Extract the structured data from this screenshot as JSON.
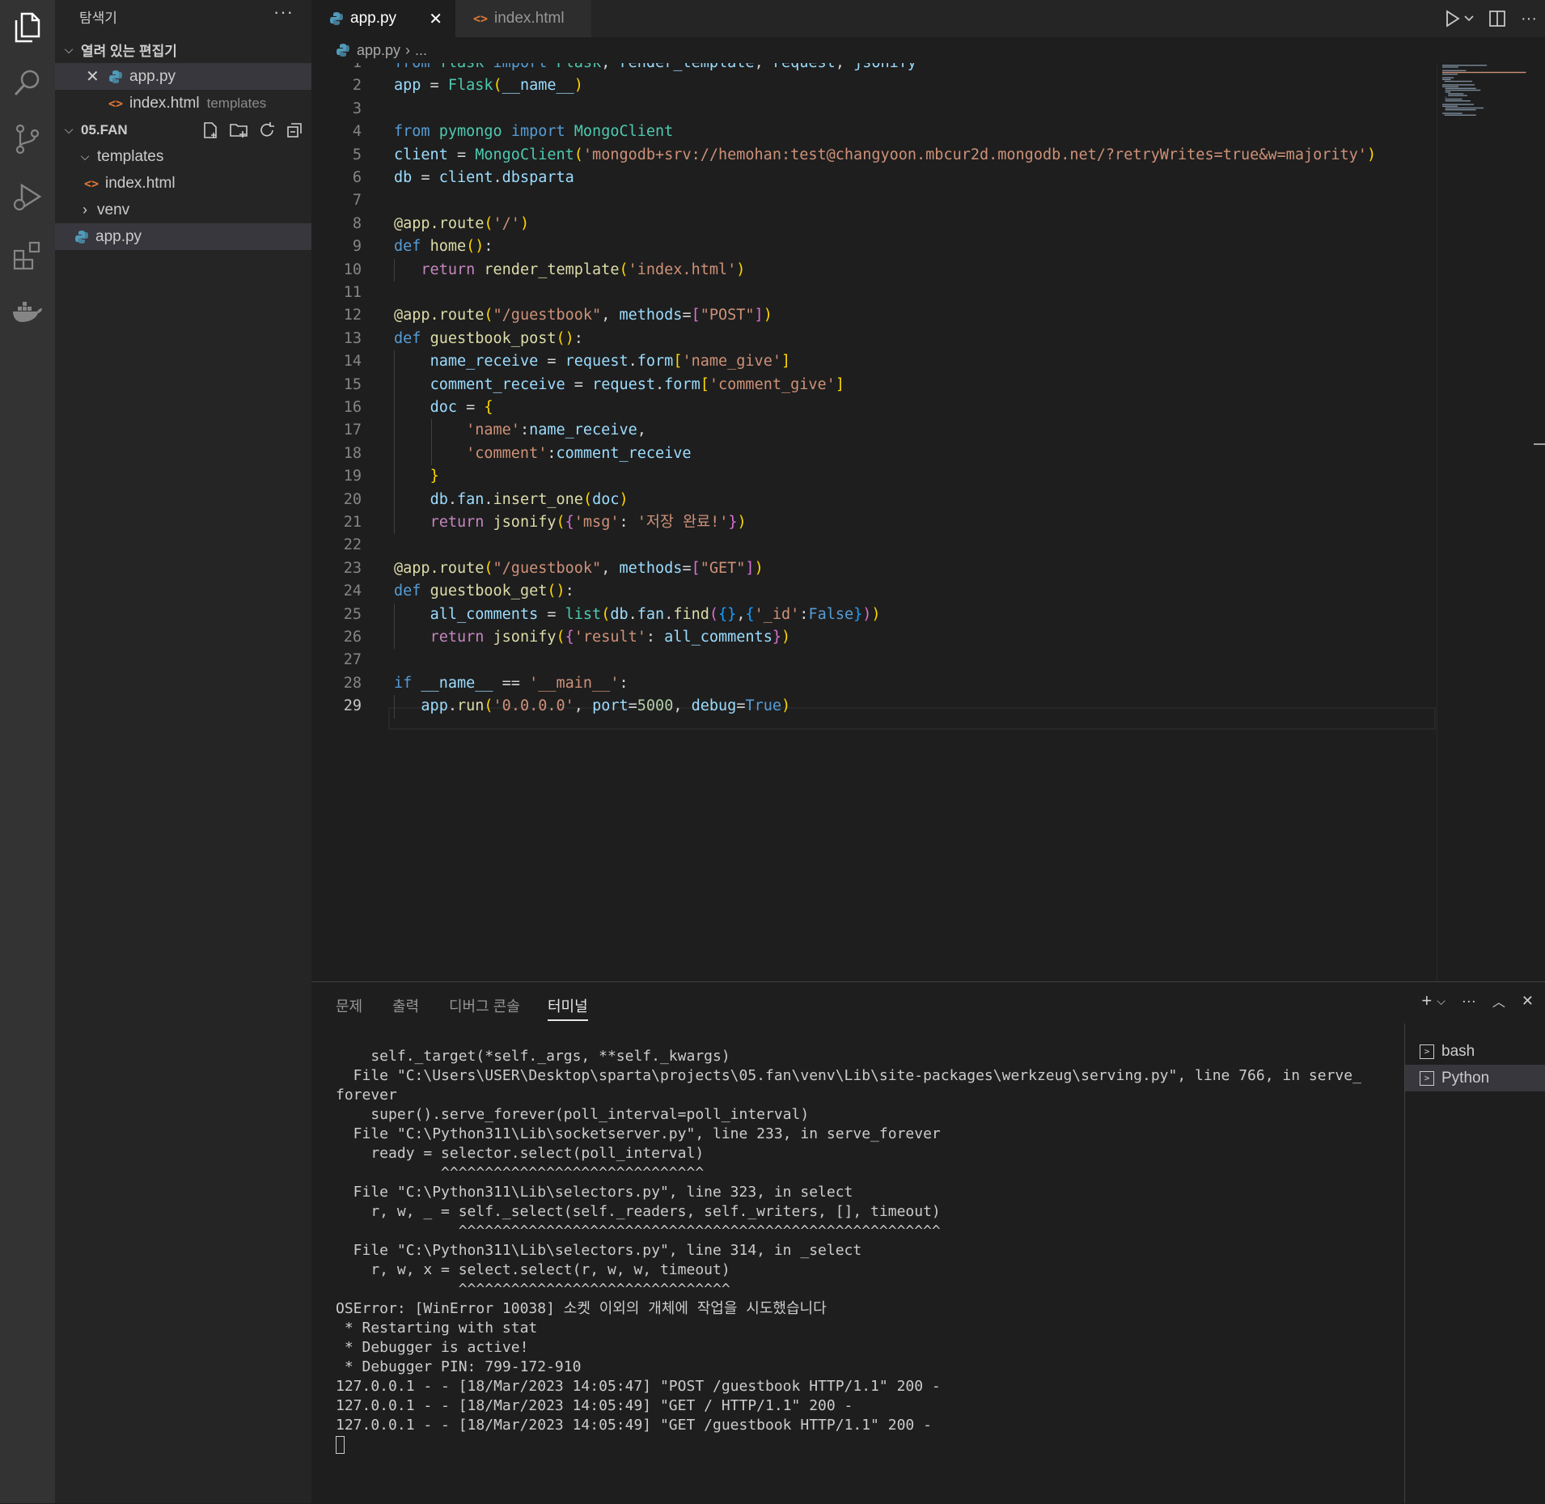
{
  "colors": {
    "accent": "#007acc",
    "python_icon": "#519aba",
    "html_icon": "#e37933"
  },
  "sidebar": {
    "title": "탐색기",
    "open_editors_label": "열려 있는 편집기",
    "open_editors": [
      {
        "name": "app.py",
        "desc": ""
      },
      {
        "name": "index.html",
        "desc": "templates"
      }
    ],
    "project_label": "05.FAN",
    "tree": [
      {
        "name": "templates",
        "type": "folder",
        "expanded": true
      },
      {
        "name": "index.html",
        "type": "file"
      },
      {
        "name": "venv",
        "type": "folder",
        "expanded": false
      },
      {
        "name": "app.py",
        "type": "file"
      }
    ]
  },
  "tabs": [
    {
      "name": "app.py",
      "active": true
    },
    {
      "name": "index.html",
      "active": false
    }
  ],
  "breadcrumb": {
    "file": "app.py",
    "rest": "..."
  },
  "editor": {
    "current_line": 29,
    "lines": [
      "from flask import Flask, render_template, request, jsonify",
      "app = Flask(__name__)",
      "",
      "from pymongo import MongoClient",
      "client = MongoClient('mongodb+srv://hemohan:test@changyoon.mbcur2d.mongodb.net/?retryWrites=true&w=majority')",
      "db = client.dbsparta",
      "",
      "@app.route('/')",
      "def home():",
      "   return render_template('index.html')",
      "",
      "@app.route(\"/guestbook\", methods=[\"POST\"])",
      "def guestbook_post():",
      "    name_receive = request.form['name_give']",
      "    comment_receive = request.form['comment_give']",
      "    doc = {",
      "        'name':name_receive,",
      "        'comment':comment_receive",
      "    }",
      "    db.fan.insert_one(doc)",
      "    return jsonify({'msg': '저장 완료!'})",
      "",
      "@app.route(\"/guestbook\", methods=[\"GET\"])",
      "def guestbook_get():",
      "    all_comments = list(db.fan.find({},{'_id':False}))",
      "    return jsonify({'result': all_comments})",
      "",
      "if __name__ == '__main__':",
      "   app.run('0.0.0.0', port=5000, debug=True)"
    ]
  },
  "panel": {
    "tabs": [
      "문제",
      "출력",
      "디버그 콘솔",
      "터미널"
    ],
    "active_tab": "터미널",
    "terminal_lines": [
      "    self._target(*self._args, **self._kwargs)",
      "  File \"C:\\Users\\USER\\Desktop\\sparta\\projects\\05.fan\\venv\\Lib\\site-packages\\werkzeug\\serving.py\", line 766, in serve_",
      "forever",
      "    super().serve_forever(poll_interval=poll_interval)",
      "  File \"C:\\Python311\\Lib\\socketserver.py\", line 233, in serve_forever",
      "    ready = selector.select(poll_interval)",
      "            ^^^^^^^^^^^^^^^^^^^^^^^^^^^^^^",
      "  File \"C:\\Python311\\Lib\\selectors.py\", line 323, in select",
      "    r, w, _ = self._select(self._readers, self._writers, [], timeout)",
      "              ^^^^^^^^^^^^^^^^^^^^^^^^^^^^^^^^^^^^^^^^^^^^^^^^^^^^^^^",
      "  File \"C:\\Python311\\Lib\\selectors.py\", line 314, in _select",
      "    r, w, x = select.select(r, w, w, timeout)",
      "              ^^^^^^^^^^^^^^^^^^^^^^^^^^^^^^^",
      "OSError: [WinError 10038] 소켓 이외의 개체에 작업을 시도했습니다",
      " * Restarting with stat",
      " * Debugger is active!",
      " * Debugger PIN: 799-172-910",
      "127.0.0.1 - - [18/Mar/2023 14:05:47] \"POST /guestbook HTTP/1.1\" 200 -",
      "127.0.0.1 - - [18/Mar/2023 14:05:49] \"GET / HTTP/1.1\" 200 -",
      "127.0.0.1 - - [18/Mar/2023 14:05:49] \"GET /guestbook HTTP/1.1\" 200 -"
    ],
    "terminals": [
      {
        "name": "bash",
        "selected": false
      },
      {
        "name": "Python",
        "selected": true
      }
    ]
  }
}
